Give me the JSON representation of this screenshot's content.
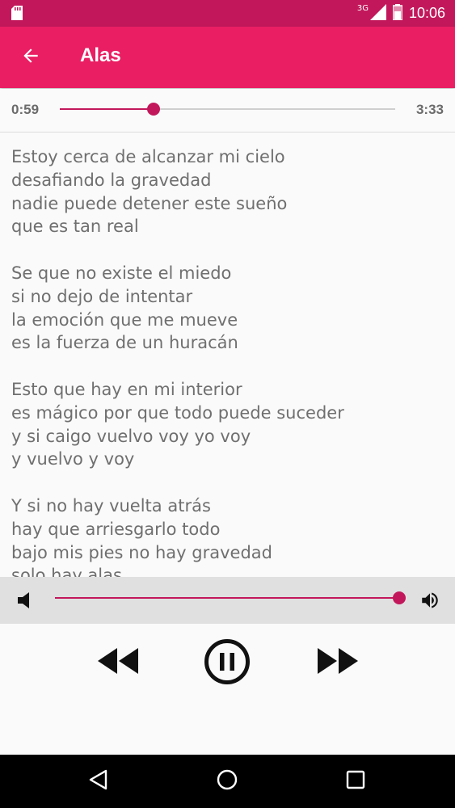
{
  "status_bar": {
    "network_label": "3G",
    "time": "10:06",
    "icons": [
      "sd-card-icon",
      "signal-icon",
      "battery-icon"
    ]
  },
  "toolbar": {
    "title": "Alas",
    "back_icon": "arrow-left-icon"
  },
  "player": {
    "elapsed": "0:59",
    "duration": "3:33",
    "progress_fraction": 0.28,
    "volume_fraction": 1.0
  },
  "lyrics": {
    "stanzas": [
      [
        "Estoy cerca de alcanzar mi cielo",
        "desafiando la gravedad",
        "nadie puede detener este sueño",
        "que es tan real"
      ],
      [
        "Se que no existe el miedo",
        "si no dejo de intentar",
        "la emoción que me mueve",
        "es la fuerza de un huracán"
      ],
      [
        "Esto que hay en mi interior",
        "es mágico por que todo puede suceder",
        "y si caigo vuelvo voy yo voy",
        "y vuelvo y voy"
      ],
      [
        "Y si no hay vuelta atrás",
        "hay que arriesgarlo todo",
        "bajo mis pies no hay gravedad",
        "solo hay alas"
      ]
    ]
  },
  "controls": {
    "rewind_icon": "rewind-icon",
    "pause_icon": "pause-circle-icon",
    "forward_icon": "fast-forward-icon"
  },
  "colors": {
    "status_bar": "#c2185b",
    "toolbar": "#e91e63",
    "accent": "#c2185b",
    "lyrics_text": "#6f6f6f"
  }
}
